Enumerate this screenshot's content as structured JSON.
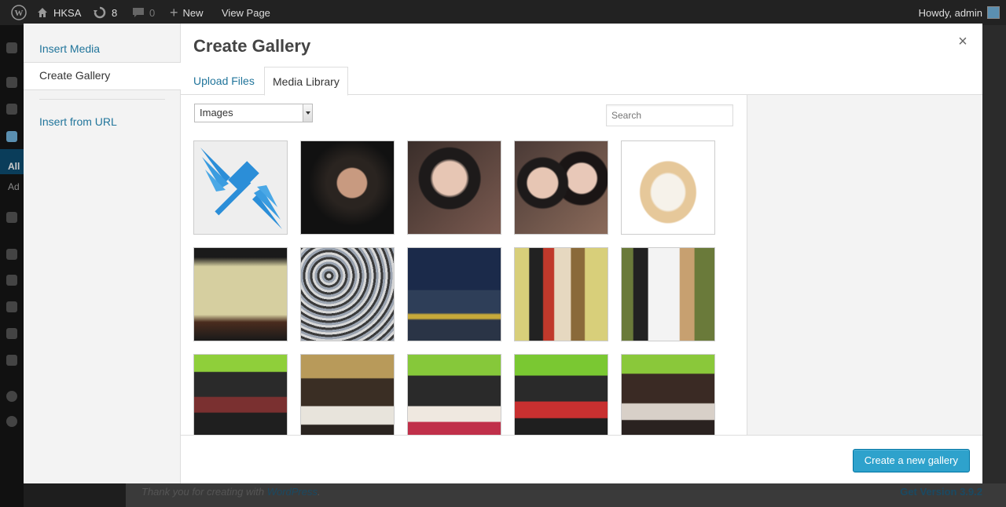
{
  "adminbar": {
    "site_name": "HKSA",
    "updates_count": "8",
    "comments_count": "0",
    "new_label": "New",
    "view_page_label": "View Page",
    "howdy_label": "Howdy, admin"
  },
  "adminmenu": {
    "all_label": "All",
    "add_label": "Ad"
  },
  "footer": {
    "thanks_prefix": "Thank you for creating with",
    "wordpress_link": "WordPress",
    "thanks_suffix": ".",
    "version_label": "Get Version 3.9.2"
  },
  "modal": {
    "title": "Create Gallery",
    "close_glyph": "×",
    "sidebar": {
      "insert_media": "Insert Media",
      "create_gallery": "Create Gallery",
      "insert_from_url": "Insert from URL"
    },
    "tabs": {
      "upload_files": "Upload Files",
      "media_library": "Media Library"
    },
    "filter_value": "Images",
    "search_placeholder": "Search",
    "primary_button": "Create a new gallery"
  },
  "colors": {
    "accent": "#21759b",
    "button": "#2ea2cc"
  },
  "thumbnails": [
    "logo",
    "portrait",
    "selfie",
    "two-girls",
    "noodle-soup",
    "bubble-tea",
    "crowd",
    "street",
    "group-standing",
    "whiteboard",
    "dinner-1",
    "dinner-2",
    "dinner-3",
    "dinner-4",
    "dinner-5"
  ]
}
